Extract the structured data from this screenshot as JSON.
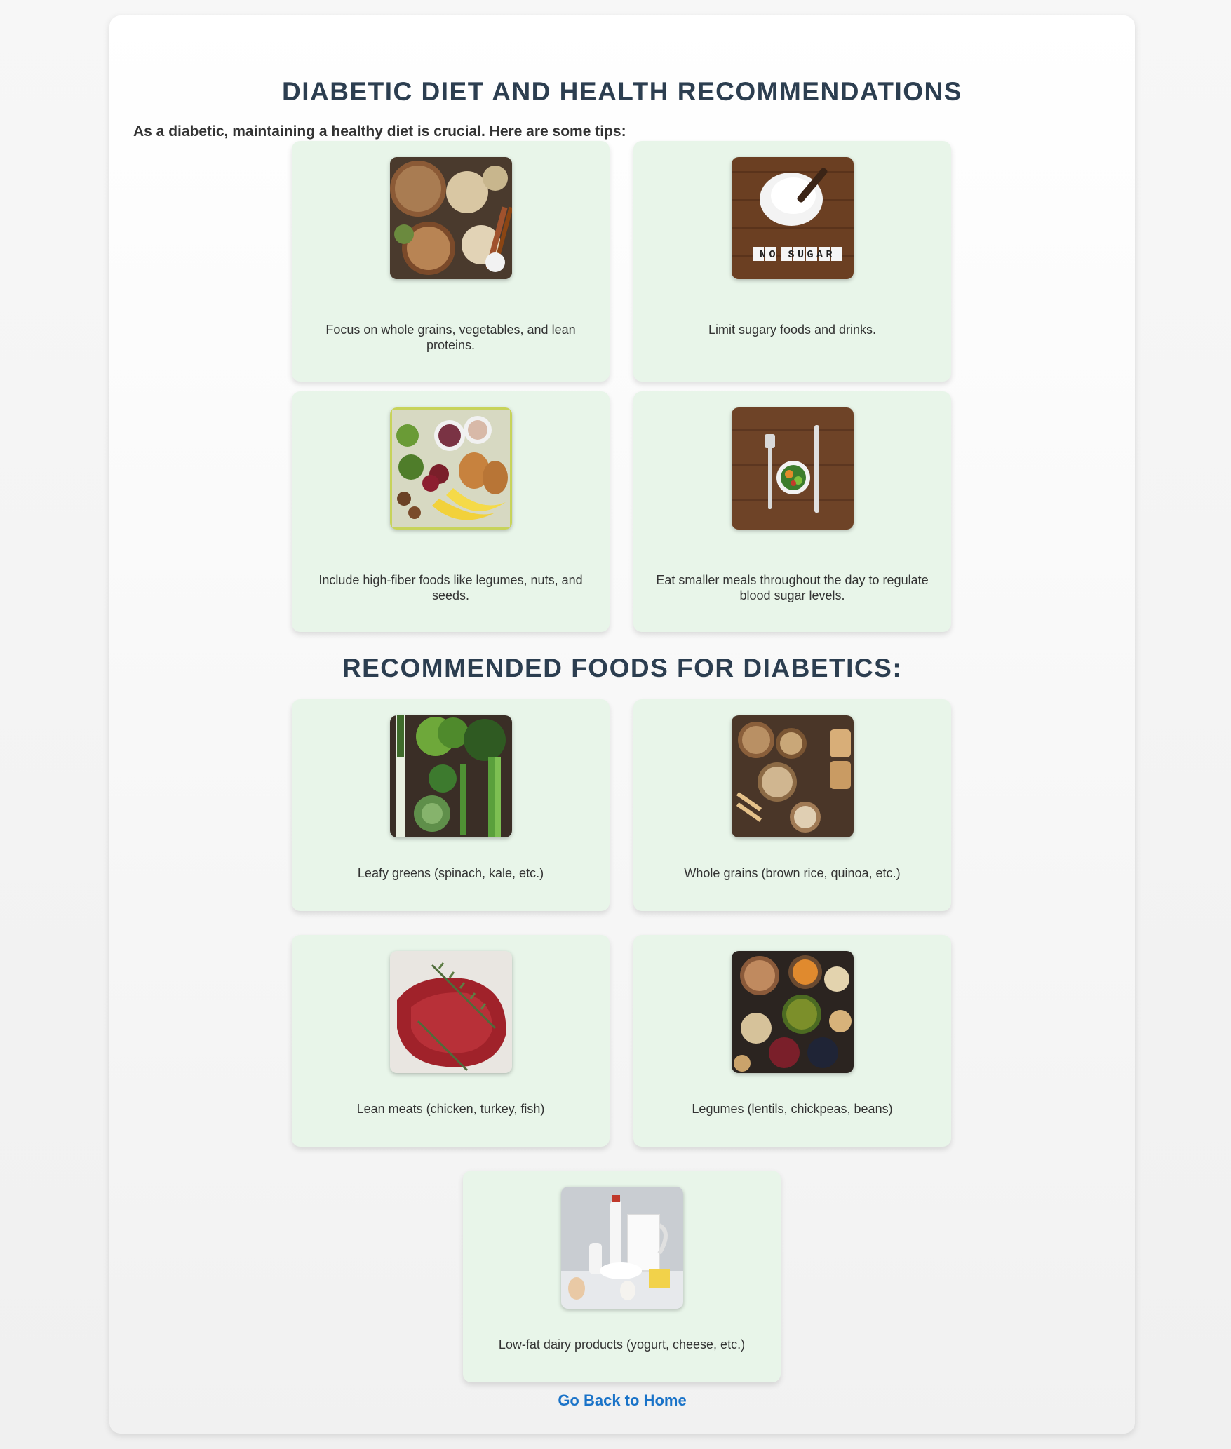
{
  "page": {
    "title": "DIABETIC DIET AND HEALTH RECOMMENDATIONS",
    "intro": "As a diabetic, maintaining a healthy diet is crucial. Here are some tips:"
  },
  "tips": [
    {
      "caption": "Focus on whole grains, vegetables, and lean proteins.",
      "icon": "whole-grains-photo"
    },
    {
      "caption": "Limit sugary foods and drinks.",
      "icon": "no-sugar-photo"
    },
    {
      "caption": "Include high-fiber foods like legumes, nuts, and seeds.",
      "icon": "high-fiber-foods-photo"
    },
    {
      "caption": "Eat smaller meals throughout the day to regulate blood sugar levels.",
      "icon": "small-meal-photo"
    }
  ],
  "foods_section": {
    "title": "RECOMMENDED FOODS FOR DIABETICS:"
  },
  "foods": [
    {
      "caption": "Leafy greens (spinach, kale, etc.)",
      "icon": "leafy-greens-photo"
    },
    {
      "caption": "Whole grains (brown rice, quinoa, etc.)",
      "icon": "grains-photo"
    },
    {
      "caption": "Lean meats (chicken, turkey, fish)",
      "icon": "lean-meat-photo"
    },
    {
      "caption": "Legumes (lentils, chickpeas, beans)",
      "icon": "legumes-photo"
    },
    {
      "caption": "Low-fat dairy products (yogurt, cheese, etc.)",
      "icon": "dairy-photo"
    }
  ],
  "no_sugar_sign": "NO SUGAR",
  "navigation": {
    "back_label": "Go Back to Home"
  },
  "colors": {
    "card_background": "#e8f5e9",
    "heading": "#2c3e50",
    "link": "#1a73c8"
  }
}
